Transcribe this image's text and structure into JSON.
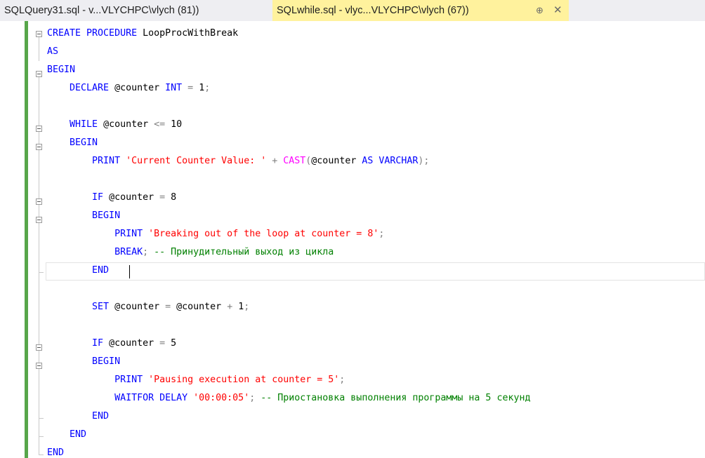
{
  "tabs": [
    {
      "label": "SQLQuery31.sql - v...VLYCHPC\\vlych (81))"
    },
    {
      "label": "SQLwhile.sql - vlyc...VLYCHPC\\vlych (67))",
      "pin_icon": "pin-icon",
      "close_icon": "close-icon",
      "pin_glyph": "⊕",
      "close_glyph": "✕"
    }
  ],
  "active_tab_color": "#fff29d",
  "code_lines": [
    [
      {
        "t": "CREATE PROCEDURE",
        "c": "kw"
      },
      {
        "t": " LoopProcWithBreak",
        "c": "id"
      }
    ],
    [
      {
        "t": "AS",
        "c": "kw"
      }
    ],
    [
      {
        "t": "BEGIN",
        "c": "kw"
      }
    ],
    [
      {
        "t": "    DECLARE",
        "c": "kw"
      },
      {
        "t": " @counter ",
        "c": "id"
      },
      {
        "t": "INT",
        "c": "kw"
      },
      {
        "t": " = ",
        "c": "op"
      },
      {
        "t": "1",
        "c": "id"
      },
      {
        "t": ";",
        "c": "op"
      }
    ],
    [],
    [
      {
        "t": "    WHILE",
        "c": "kw"
      },
      {
        "t": " @counter ",
        "c": "id"
      },
      {
        "t": "<=",
        "c": "op"
      },
      {
        "t": " 10",
        "c": "id"
      }
    ],
    [
      {
        "t": "    BEGIN",
        "c": "kw"
      }
    ],
    [
      {
        "t": "        PRINT ",
        "c": "kw"
      },
      {
        "t": "'Current Counter Value: '",
        "c": "str"
      },
      {
        "t": " + ",
        "c": "op"
      },
      {
        "t": "CAST",
        "c": "fn"
      },
      {
        "t": "(",
        "c": "op"
      },
      {
        "t": "@counter ",
        "c": "id"
      },
      {
        "t": "AS VARCHAR",
        "c": "kw"
      },
      {
        "t": ");",
        "c": "op"
      }
    ],
    [],
    [
      {
        "t": "        IF",
        "c": "kw"
      },
      {
        "t": " @counter ",
        "c": "id"
      },
      {
        "t": "=",
        "c": "op"
      },
      {
        "t": " 8",
        "c": "id"
      }
    ],
    [
      {
        "t": "        BEGIN",
        "c": "kw"
      }
    ],
    [
      {
        "t": "            PRINT ",
        "c": "kw"
      },
      {
        "t": "'Breaking out of the loop at counter = 8'",
        "c": "str"
      },
      {
        "t": ";",
        "c": "op"
      }
    ],
    [
      {
        "t": "            BREAK",
        "c": "kw"
      },
      {
        "t": "; ",
        "c": "op"
      },
      {
        "t": "-- Принудительный выход из цикла",
        "c": "cm"
      }
    ],
    [
      {
        "t": "        END",
        "c": "kw"
      }
    ],
    [],
    [
      {
        "t": "        SET",
        "c": "kw"
      },
      {
        "t": " @counter ",
        "c": "id"
      },
      {
        "t": "=",
        "c": "op"
      },
      {
        "t": " @counter ",
        "c": "id"
      },
      {
        "t": "+",
        "c": "op"
      },
      {
        "t": " 1",
        "c": "id"
      },
      {
        "t": ";",
        "c": "op"
      }
    ],
    [],
    [
      {
        "t": "        IF",
        "c": "kw"
      },
      {
        "t": " @counter ",
        "c": "id"
      },
      {
        "t": "=",
        "c": "op"
      },
      {
        "t": " 5",
        "c": "id"
      }
    ],
    [
      {
        "t": "        BEGIN",
        "c": "kw"
      }
    ],
    [
      {
        "t": "            PRINT ",
        "c": "kw"
      },
      {
        "t": "'Pausing execution at counter = 5'",
        "c": "str"
      },
      {
        "t": ";",
        "c": "op"
      }
    ],
    [
      {
        "t": "            WAITFOR DELAY ",
        "c": "kw"
      },
      {
        "t": "'00:00:05'",
        "c": "str"
      },
      {
        "t": "; ",
        "c": "op"
      },
      {
        "t": "-- Приостановка выполнения программы на 5 секунд",
        "c": "cm"
      }
    ],
    [
      {
        "t": "        END",
        "c": "kw"
      }
    ],
    [
      {
        "t": "    END",
        "c": "kw"
      }
    ],
    [
      {
        "t": "END",
        "c": "kw"
      }
    ]
  ]
}
